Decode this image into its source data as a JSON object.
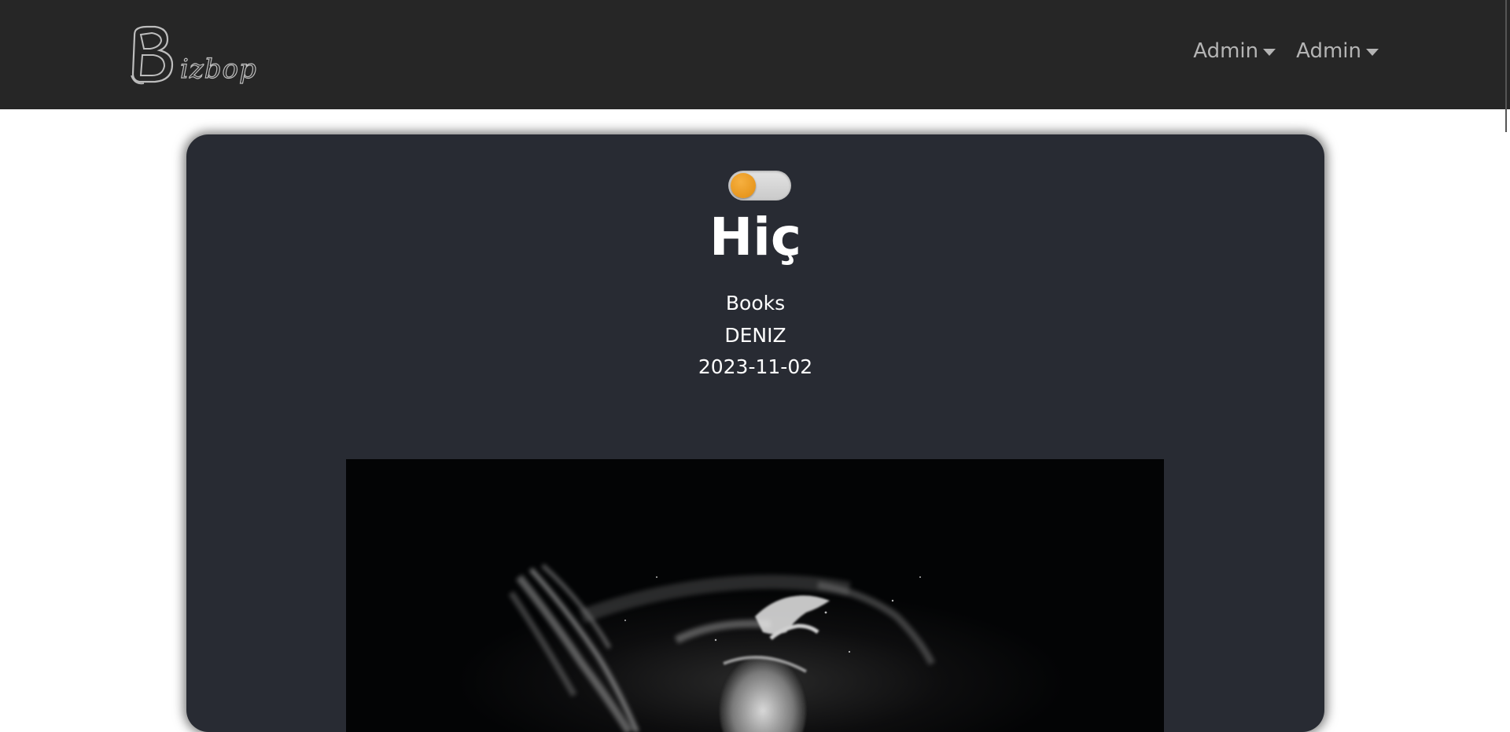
{
  "navbar": {
    "brand_text": "izbop",
    "brand_icon": "b-letter-logo",
    "menus": [
      {
        "label": "Admin",
        "icon": "caret-down-icon"
      },
      {
        "label": "Admin",
        "icon": "caret-down-icon"
      }
    ],
    "background": "#262626"
  },
  "post": {
    "theme_toggle_icon": "toggle-switch",
    "title": "Hiç",
    "category": "Books",
    "author": "DENIZ",
    "date": "2023-11-02",
    "card_background": "#282b33",
    "toggle_accent": "#f0a030"
  }
}
